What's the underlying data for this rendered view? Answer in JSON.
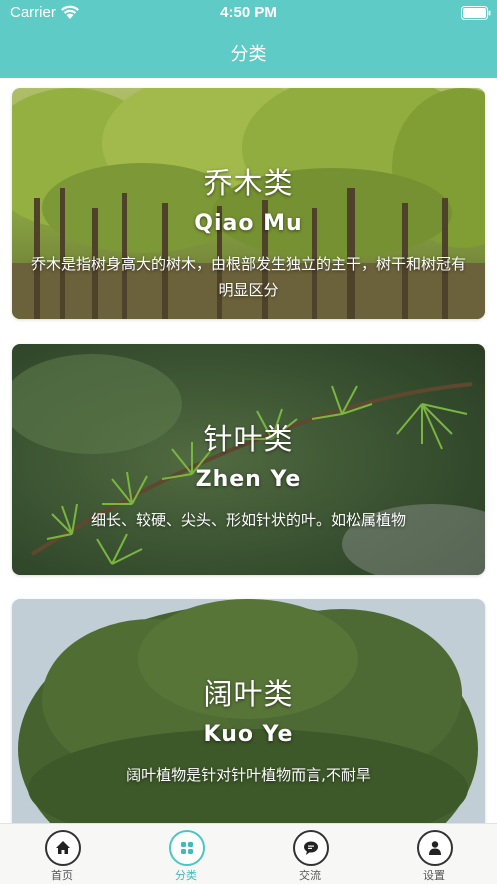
{
  "status_bar": {
    "carrier": "Carrier",
    "time": "4:50 PM"
  },
  "nav": {
    "title": "分类"
  },
  "categories": [
    {
      "title": "乔木类",
      "pinyin": "Qiao Mu",
      "description": "乔木是指树身高大的树木，由根部发生独立的主干，树干和树冠有明显区分"
    },
    {
      "title": "针叶类",
      "pinyin": "Zhen Ye",
      "description": "细长、较硬、尖头、形如针状的叶。如松属植物"
    },
    {
      "title": "阔叶类",
      "pinyin": "Kuo Ye",
      "description": "阔叶植物是针对针叶植物而言,不耐旱"
    }
  ],
  "tabs": [
    {
      "label": "首页",
      "icon": "home-icon"
    },
    {
      "label": "分类",
      "icon": "grid-icon",
      "active": true
    },
    {
      "label": "交流",
      "icon": "chat-icon"
    },
    {
      "label": "设置",
      "icon": "person-icon"
    }
  ],
  "colors": {
    "header": "#5fcbc7",
    "accent": "#3dbcbd",
    "tabbar": "#f7f7f5"
  }
}
